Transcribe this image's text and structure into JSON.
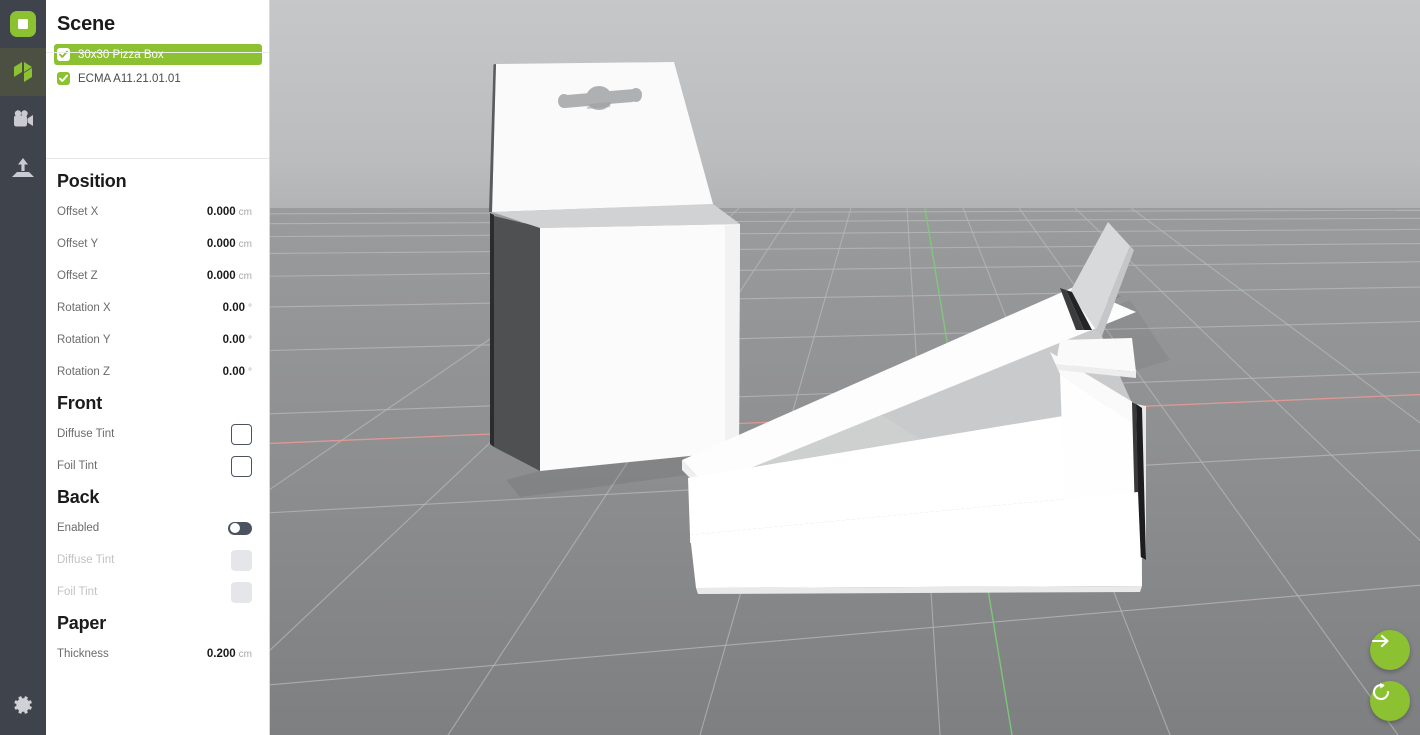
{
  "accent_green": "#8CC132",
  "rail_bg": "#3F434B",
  "rail_active_bg": "#4B5042",
  "viewport_bg_top": "#C5C6C8",
  "viewport_bg_bottom": "#B1B2B4",
  "floor_color": "#8E8F91",
  "grid_line_color": "#B9BABC",
  "axis_x_color": "#E79A96",
  "axis_z_color": "#7DCB78",
  "rail": {
    "items": [
      {
        "name": "logo-icon",
        "label": "App Logo",
        "active": false
      },
      {
        "name": "shapes-icon",
        "label": "Shapes",
        "active": true
      },
      {
        "name": "camera-icon",
        "label": "Camera",
        "active": false
      },
      {
        "name": "export-icon",
        "label": "Export",
        "active": false
      }
    ],
    "bottom": {
      "name": "gear-icon",
      "label": "Settings"
    }
  },
  "panel": {
    "header": "Scene",
    "scene_items": [
      {
        "label": "30x30 Pizza Box",
        "checked": true,
        "selected": true
      },
      {
        "label": "ECMA A11.21.01.01",
        "checked": true,
        "selected": false
      }
    ],
    "sections": [
      {
        "title": "Position",
        "rows": [
          {
            "label": "Offset X",
            "value": "0.000",
            "unit": "cm",
            "control": "value"
          },
          {
            "label": "Offset Y",
            "value": "0.000",
            "unit": "cm",
            "control": "value"
          },
          {
            "label": "Offset Z",
            "value": "0.000",
            "unit": "cm",
            "control": "value"
          },
          {
            "label": "Rotation X",
            "value": "0.00",
            "unit": "°",
            "control": "value"
          },
          {
            "label": "Rotation Y",
            "value": "0.00",
            "unit": "°",
            "control": "value"
          },
          {
            "label": "Rotation Z",
            "value": "0.00",
            "unit": "°",
            "control": "value"
          }
        ]
      },
      {
        "title": "Front",
        "rows": [
          {
            "label": "Diffuse Tint",
            "value": "",
            "unit": "",
            "control": "swatch",
            "swatch_color": "#FFFFFF",
            "disabled": false
          },
          {
            "label": "Foil Tint",
            "value": "",
            "unit": "",
            "control": "swatch",
            "swatch_color": "#FFFFFF",
            "disabled": false
          }
        ]
      },
      {
        "title": "Back",
        "rows": [
          {
            "label": "Enabled",
            "value": "",
            "unit": "",
            "control": "toggle",
            "toggle_on": false,
            "disabled": false
          },
          {
            "label": "Diffuse Tint",
            "value": "",
            "unit": "",
            "control": "swatch",
            "swatch_color": "#E4E6E9",
            "disabled": true
          },
          {
            "label": "Foil Tint",
            "value": "",
            "unit": "",
            "control": "swatch",
            "swatch_color": "#E4E6E9",
            "disabled": true
          }
        ]
      },
      {
        "title": "Paper",
        "rows": [
          {
            "label": "Thickness",
            "value": "0.200",
            "unit": "cm",
            "control": "value"
          }
        ]
      }
    ]
  },
  "viewport": {
    "fab_next": {
      "name": "arrow-right-icon",
      "label": "Next"
    },
    "fab_reset": {
      "name": "reset-icon",
      "label": "Reset View"
    }
  }
}
